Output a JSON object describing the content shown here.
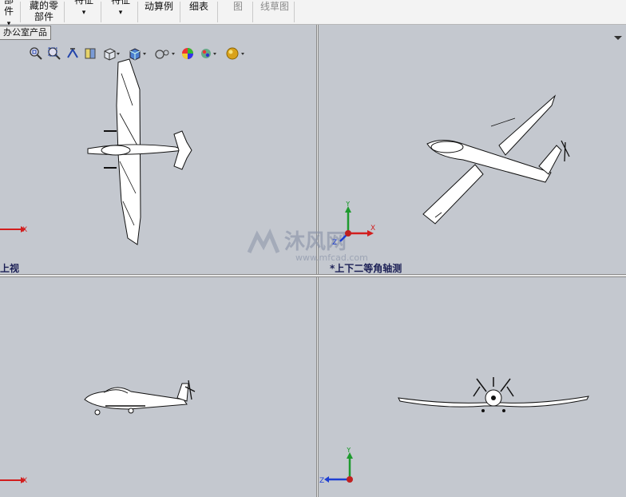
{
  "ribbon": {
    "items": [
      {
        "label": "部件",
        "arrow": "▾"
      },
      {
        "label": "藏的零\n部件"
      },
      {
        "label": "特征",
        "arrow": "▾"
      },
      {
        "label": "特征",
        "arrow": "▾"
      },
      {
        "label": "动算例"
      },
      {
        "label": "细表"
      },
      {
        "label": "图"
      },
      {
        "label": "线草图"
      }
    ]
  },
  "document_tab": "办公室产品",
  "viewports": {
    "top_left": "上视",
    "top_right": "*上下二等角轴测",
    "bottom_left": "",
    "bottom_right": ""
  },
  "triad": {
    "x": "X",
    "y": "Y",
    "z": "Z"
  },
  "watermark": {
    "brand": "沐风网",
    "url": "www.mfcad.com"
  },
  "colors": {
    "background": "#c4c8cf",
    "label": "#1b1f55",
    "axis_x": "#d21e1e",
    "axis_y": "#1e9a2e",
    "axis_z": "#1e3fd2"
  },
  "heads_up_toolbar": [
    "zoom-to-fit-icon",
    "zoom-to-area-icon",
    "previous-view-icon",
    "section-view-icon",
    "view-orientation-icon",
    "display-style-icon",
    "hide-show-items-icon",
    "edit-appearance-icon",
    "apply-scene-icon",
    "view-settings-icon"
  ]
}
